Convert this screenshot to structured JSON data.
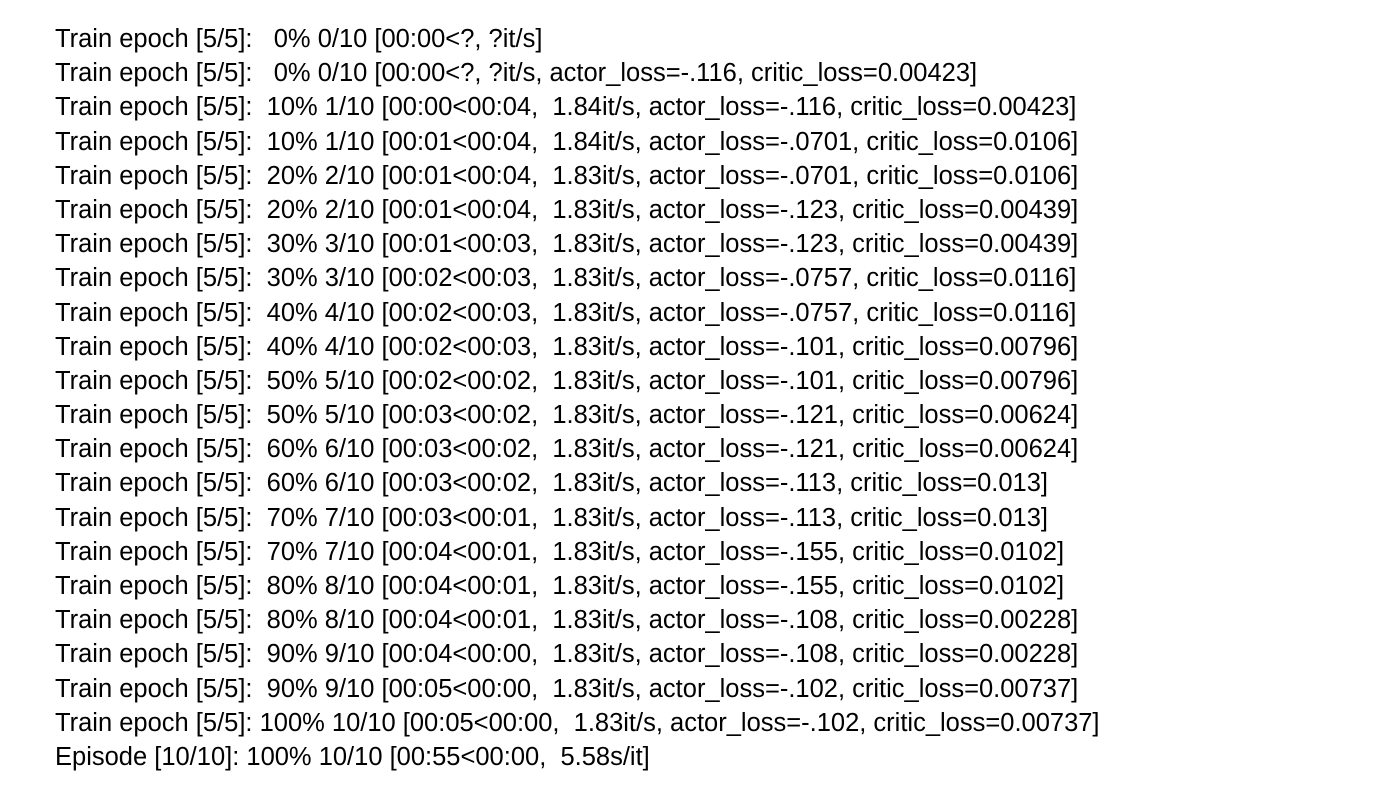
{
  "log_lines": [
    "Train epoch [5/5]:   0% 0/10 [00:00<?, ?it/s]",
    "Train epoch [5/5]:   0% 0/10 [00:00<?, ?it/s, actor_loss=-.116, critic_loss=0.00423]",
    "Train epoch [5/5]:  10% 1/10 [00:00<00:04,  1.84it/s, actor_loss=-.116, critic_loss=0.00423]",
    "Train epoch [5/5]:  10% 1/10 [00:01<00:04,  1.84it/s, actor_loss=-.0701, critic_loss=0.0106]",
    "Train epoch [5/5]:  20% 2/10 [00:01<00:04,  1.83it/s, actor_loss=-.0701, critic_loss=0.0106]",
    "Train epoch [5/5]:  20% 2/10 [00:01<00:04,  1.83it/s, actor_loss=-.123, critic_loss=0.00439]",
    "Train epoch [5/5]:  30% 3/10 [00:01<00:03,  1.83it/s, actor_loss=-.123, critic_loss=0.00439]",
    "Train epoch [5/5]:  30% 3/10 [00:02<00:03,  1.83it/s, actor_loss=-.0757, critic_loss=0.0116]",
    "Train epoch [5/5]:  40% 4/10 [00:02<00:03,  1.83it/s, actor_loss=-.0757, critic_loss=0.0116]",
    "Train epoch [5/5]:  40% 4/10 [00:02<00:03,  1.83it/s, actor_loss=-.101, critic_loss=0.00796]",
    "Train epoch [5/5]:  50% 5/10 [00:02<00:02,  1.83it/s, actor_loss=-.101, critic_loss=0.00796]",
    "Train epoch [5/5]:  50% 5/10 [00:03<00:02,  1.83it/s, actor_loss=-.121, critic_loss=0.00624]",
    "Train epoch [5/5]:  60% 6/10 [00:03<00:02,  1.83it/s, actor_loss=-.121, critic_loss=0.00624]",
    "Train epoch [5/5]:  60% 6/10 [00:03<00:02,  1.83it/s, actor_loss=-.113, critic_loss=0.013]",
    "Train epoch [5/5]:  70% 7/10 [00:03<00:01,  1.83it/s, actor_loss=-.113, critic_loss=0.013]",
    "Train epoch [5/5]:  70% 7/10 [00:04<00:01,  1.83it/s, actor_loss=-.155, critic_loss=0.0102]",
    "Train epoch [5/5]:  80% 8/10 [00:04<00:01,  1.83it/s, actor_loss=-.155, critic_loss=0.0102]",
    "Train epoch [5/5]:  80% 8/10 [00:04<00:01,  1.83it/s, actor_loss=-.108, critic_loss=0.00228]",
    "Train epoch [5/5]:  90% 9/10 [00:04<00:00,  1.83it/s, actor_loss=-.108, critic_loss=0.00228]",
    "Train epoch [5/5]:  90% 9/10 [00:05<00:00,  1.83it/s, actor_loss=-.102, critic_loss=0.00737]",
    "Train epoch [5/5]: 100% 10/10 [00:05<00:00,  1.83it/s, actor_loss=-.102, critic_loss=0.00737]",
    "Episode [10/10]: 100% 10/10 [00:55<00:00,  5.58s/it]"
  ],
  "colors": {
    "background": "#ffffff",
    "text": "#000000"
  }
}
